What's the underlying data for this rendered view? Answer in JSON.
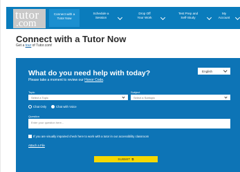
{
  "brand": {
    "line1": "tutor",
    "line2": ".com"
  },
  "nav": {
    "connect_line1": "Connect with a",
    "connect_line2": "Tutor Now",
    "schedule_line1": "Schedule a",
    "schedule_line2": "Session",
    "dropoff_line1": "Drop Off",
    "dropoff_line2": "Your Work",
    "testprep_line1": "Test Prep and",
    "testprep_line2": "Self-Study",
    "account_line1": "My",
    "account_line2": "Account"
  },
  "page": {
    "title": "Connect with a Tutor Now",
    "subtitle_prefix": "Get a ",
    "subtitle_link": "tour",
    "subtitle_suffix": " of Tutor.com!"
  },
  "form": {
    "title": "What do you need help with today?",
    "sub_prefix": "Please take a moment to review our ",
    "sub_link": "Honor Code",
    "sub_suffix": ".",
    "language": "English",
    "topic_label": "Topic",
    "topic_placeholder": "Select a Topic",
    "subject_label": "Subject",
    "subject_placeholder": "Select a Subtopic",
    "chat_only": "Chat Only",
    "chat_voice": "Chat with Voice",
    "question_label": "Question",
    "question_placeholder": "Enter your question here...",
    "accessibility_text": "If you are visually impaired check here to work with a tutor in our accessibility classroom",
    "attach_label": "Attach a File",
    "submit_label": "SUBMIT",
    "submit_icon": "external-link-icon"
  },
  "colors": {
    "nav": "#0a7cbc",
    "panel": "#0d74b6",
    "submit": "#f5d800"
  }
}
